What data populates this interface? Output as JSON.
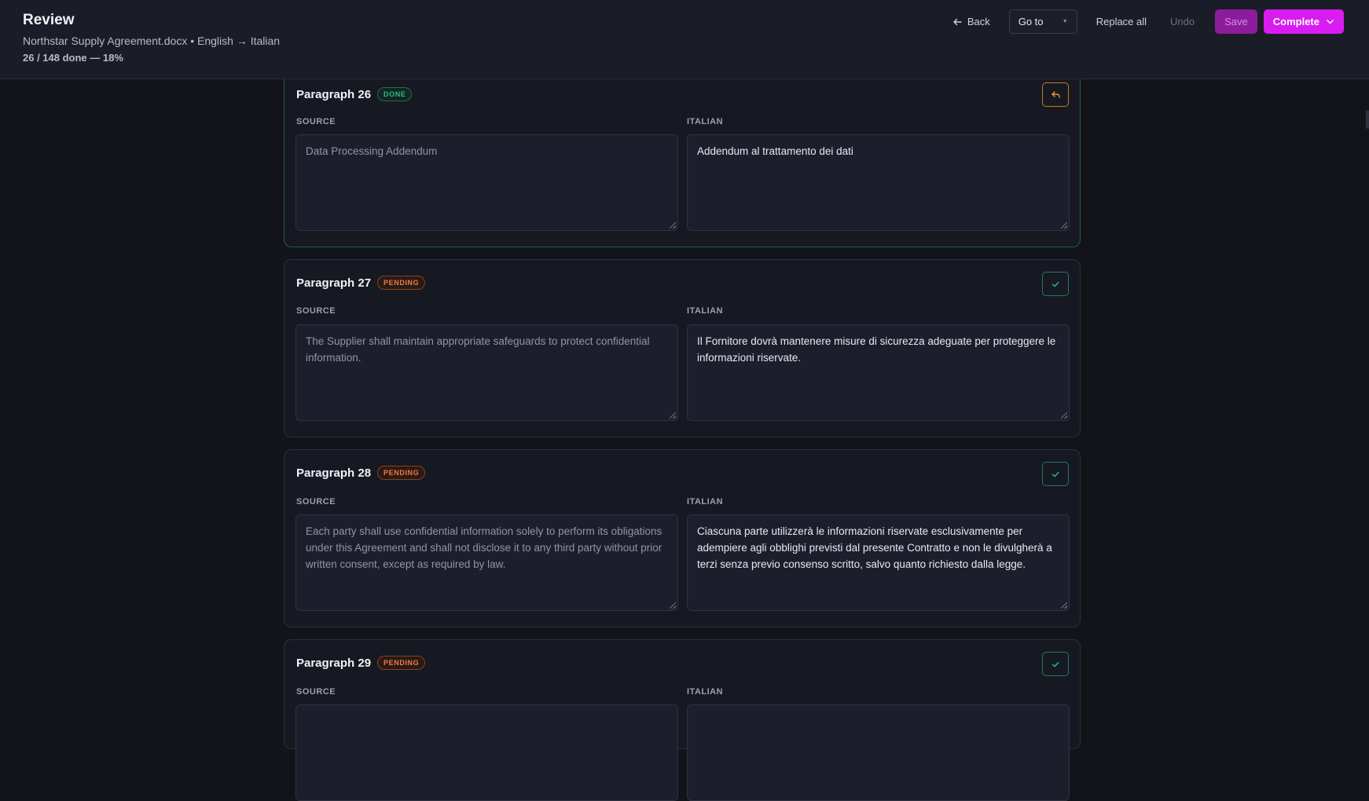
{
  "header": {
    "title": "Review",
    "subtitle": "Northstar Supply Agreement.docx • English → Italian",
    "progress": "26 / 148 done — 18%"
  },
  "toolbar": {
    "back_label": "Back",
    "goto_label": "Go to",
    "replace_all_label": "Replace all",
    "undo_label": "Undo",
    "save_label": "Save",
    "complete_label": "Complete"
  },
  "labels": {
    "source": "SOURCE",
    "target": "ITALIAN"
  },
  "paragraphs": [
    {
      "title": "Paragraph 26",
      "status": "DONE",
      "source": "Data Processing Addendum",
      "target": "Addendum al trattamento dei dati"
    },
    {
      "title": "Paragraph 27",
      "status": "PENDING",
      "source": "The Supplier shall maintain appropriate safeguards to protect confidential information.",
      "target": "Il Fornitore dovrà mantenere misure di sicurezza adeguate per proteggere le informazioni riservate."
    },
    {
      "title": "Paragraph 28",
      "status": "PENDING",
      "source": "Each party shall use confidential information solely to perform its obligations under this Agreement and shall not disclose it to any third party without prior written consent, except as required by law.",
      "target": "Ciascuna parte utilizzerà le informazioni riservate esclusivamente per adempiere agli obblighi previsti dal presente Contratto e non le divulgherà a terzi senza previo consenso scritto, salvo quanto richiesto dalla legge."
    },
    {
      "title": "Paragraph 29",
      "status": "PENDING",
      "source": "",
      "target": ""
    }
  ],
  "icons": {
    "back": "arrow-left-icon",
    "undo_paragraph": "undo-arrow-icon",
    "approve": "check-icon",
    "complete": "chevron-down-icon"
  },
  "colors": {
    "accent": "#d91cf0",
    "done": "#2dba8c",
    "pending": "#f07b45",
    "undo": "#e89a33"
  }
}
